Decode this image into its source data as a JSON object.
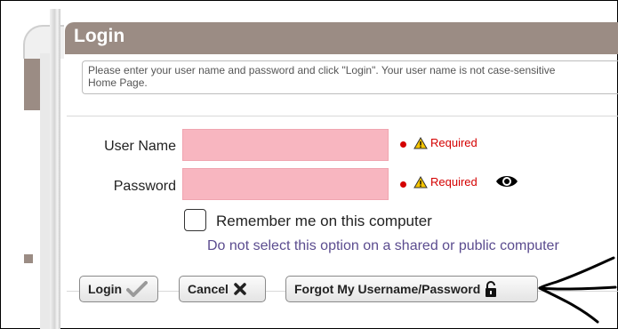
{
  "header": {
    "title": "Login"
  },
  "info": {
    "line1": "Please enter your user name and password and click \"Login\". Your user name is not case-sensitive",
    "line2": "Home Page."
  },
  "form": {
    "username_label": "User Name",
    "username_value": "",
    "password_label": "Password",
    "password_value": "",
    "required_text": "Required",
    "remember_label": "Remember me on this computer",
    "remember_checked": false,
    "remember_note": "Do not select this option on a shared or public computer"
  },
  "buttons": {
    "login": "Login",
    "cancel": "Cancel",
    "forgot": "Forgot My Username/Password"
  },
  "icons": {
    "login": "checkmark-icon",
    "cancel": "x-icon",
    "forgot": "lock-icon",
    "password_toggle": "eye-icon",
    "required": "warning-icon"
  },
  "colors": {
    "header_bg": "#9b8c84",
    "field_bg": "#f8b6c0",
    "required": "#d40000",
    "note": "#5b4c8f"
  }
}
